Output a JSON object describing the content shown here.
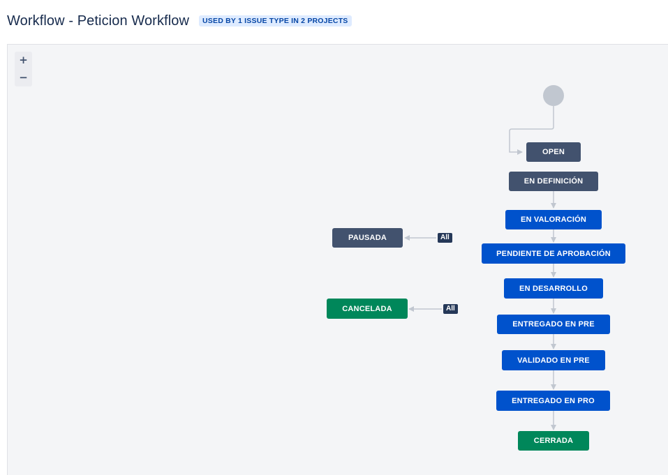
{
  "header": {
    "title": "Workflow - Peticion Workflow",
    "usage_badge": "USED BY 1 ISSUE TYPE IN 2 PROJECTS"
  },
  "zoom": {
    "in_label": "+",
    "out_label": "−"
  },
  "statuses": {
    "open": "OPEN",
    "en_definicion": "EN DEFINICIÓN",
    "en_valoracion": "EN VALORACIÓN",
    "pendiente_aprobacion": "PENDIENTE DE APROBACIÓN",
    "en_desarrollo": "EN DESARROLLO",
    "entregado_pre": "ENTREGADO EN PRE",
    "validado_pre": "VALIDADO EN PRE",
    "entregado_pro": "ENTREGADO EN PRO",
    "cerrada": "CERRADA",
    "pausada": "PAUSADA",
    "cancelada": "CANCELADA"
  },
  "global_transitions": {
    "pausada_label": "All",
    "cancelada_label": "All"
  },
  "colors": {
    "todo": "#42526e",
    "in_progress": "#0052cc",
    "done": "#00875a",
    "connector": "#c1c7d0",
    "start_node": "#c1c7d0"
  }
}
